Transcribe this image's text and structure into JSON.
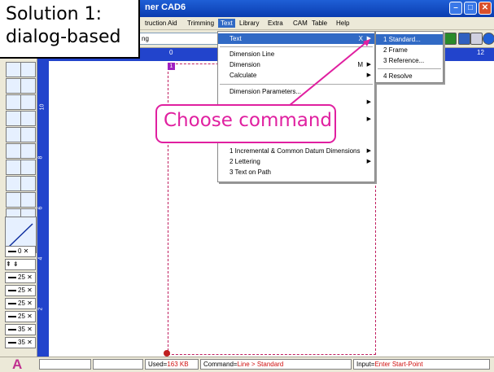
{
  "window": {
    "title": "ner CAD6",
    "minimize_icon": "minimize-icon",
    "maximize_icon": "maximize-icon",
    "close_icon": "close-icon"
  },
  "menubar": {
    "items": [
      "truction Aid",
      "Trimming",
      "Text",
      "Library",
      "Extra",
      "CAM",
      "Table",
      "Help"
    ],
    "active": "Text"
  },
  "toolbar": {
    "layer_value": "ng"
  },
  "ruler": {
    "h_labels": [
      "0",
      "12"
    ],
    "v_labels": [
      "10",
      "8",
      "6",
      "4",
      "2"
    ]
  },
  "page": {
    "marker": "1"
  },
  "text_menu": {
    "items": [
      {
        "label": "Text",
        "shortcut": "X",
        "submenu": true
      },
      {
        "label": "Dimension Line",
        "shortcut": "",
        "submenu": false
      },
      {
        "label": "Dimension",
        "shortcut": "M",
        "submenu": true
      },
      {
        "label": "Calculate",
        "shortcut": "",
        "submenu": true
      },
      {
        "label": "Dimension Parameters...",
        "shortcut": "",
        "submenu": false
      },
      {
        "label": "",
        "shortcut": "",
        "submenu": true
      },
      {
        "label": "",
        "shortcut": "",
        "submenu": true
      },
      {
        "label": "1 Incremental & Common Datum Dimensions",
        "shortcut": "",
        "submenu": true
      },
      {
        "label": "2 Lettering",
        "shortcut": "",
        "submenu": true
      },
      {
        "label": "3 Text on Path",
        "shortcut": "",
        "submenu": false
      }
    ]
  },
  "sub_menu": {
    "items": [
      "1 Standard...",
      "2 Frame",
      "3 Reference...",
      "4 Resolve"
    ]
  },
  "line_types": [
    "0",
    "",
    "25",
    "25",
    "25",
    "25",
    "35",
    "35"
  ],
  "statusbar": {
    "used_label": "Used=",
    "used_value": "163 KB",
    "command_label": "Command=",
    "command_value": "Line > Standard",
    "input_label": "Input=",
    "input_value": "Enter Start-Point"
  },
  "callouts": {
    "solution": "Solution 1:\ndialog-based",
    "choose": "Choose command"
  },
  "colors": {
    "titlebar": "#0a3cb0",
    "ruler": "#2244cc",
    "menu_highlight": "#316ac5",
    "callout_accent": "#e020a0",
    "page_border": "#c02060"
  }
}
